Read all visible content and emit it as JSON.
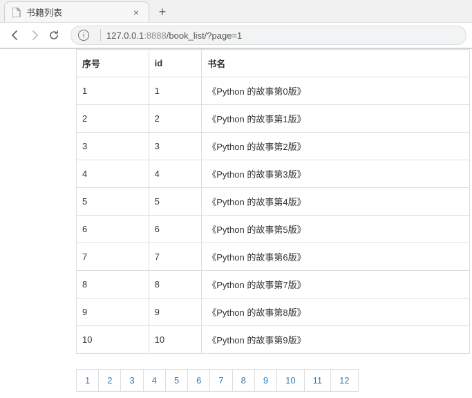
{
  "browser": {
    "tab_title": "书籍列表",
    "url_host": "127.0.0.1",
    "url_port": ":8888",
    "url_path": "/book_list/?page=1",
    "info_glyph": "i",
    "close_glyph": "×",
    "plus_glyph": "+"
  },
  "table": {
    "headers": {
      "seq": "序号",
      "id": "id",
      "name": "书名"
    },
    "rows": [
      {
        "seq": "1",
        "id": "1",
        "name": "《Python 的故事第0版》"
      },
      {
        "seq": "2",
        "id": "2",
        "name": "《Python 的故事第1版》"
      },
      {
        "seq": "3",
        "id": "3",
        "name": "《Python 的故事第2版》"
      },
      {
        "seq": "4",
        "id": "4",
        "name": "《Python 的故事第3版》"
      },
      {
        "seq": "5",
        "id": "5",
        "name": "《Python 的故事第4版》"
      },
      {
        "seq": "6",
        "id": "6",
        "name": "《Python 的故事第5版》"
      },
      {
        "seq": "7",
        "id": "7",
        "name": "《Python 的故事第6版》"
      },
      {
        "seq": "8",
        "id": "8",
        "name": "《Python 的故事第7版》"
      },
      {
        "seq": "9",
        "id": "9",
        "name": "《Python 的故事第8版》"
      },
      {
        "seq": "10",
        "id": "10",
        "name": "《Python 的故事第9版》"
      }
    ]
  },
  "pagination": {
    "pages": [
      "1",
      "2",
      "3",
      "4",
      "5",
      "6",
      "7",
      "8",
      "9",
      "10",
      "11",
      "12"
    ]
  }
}
